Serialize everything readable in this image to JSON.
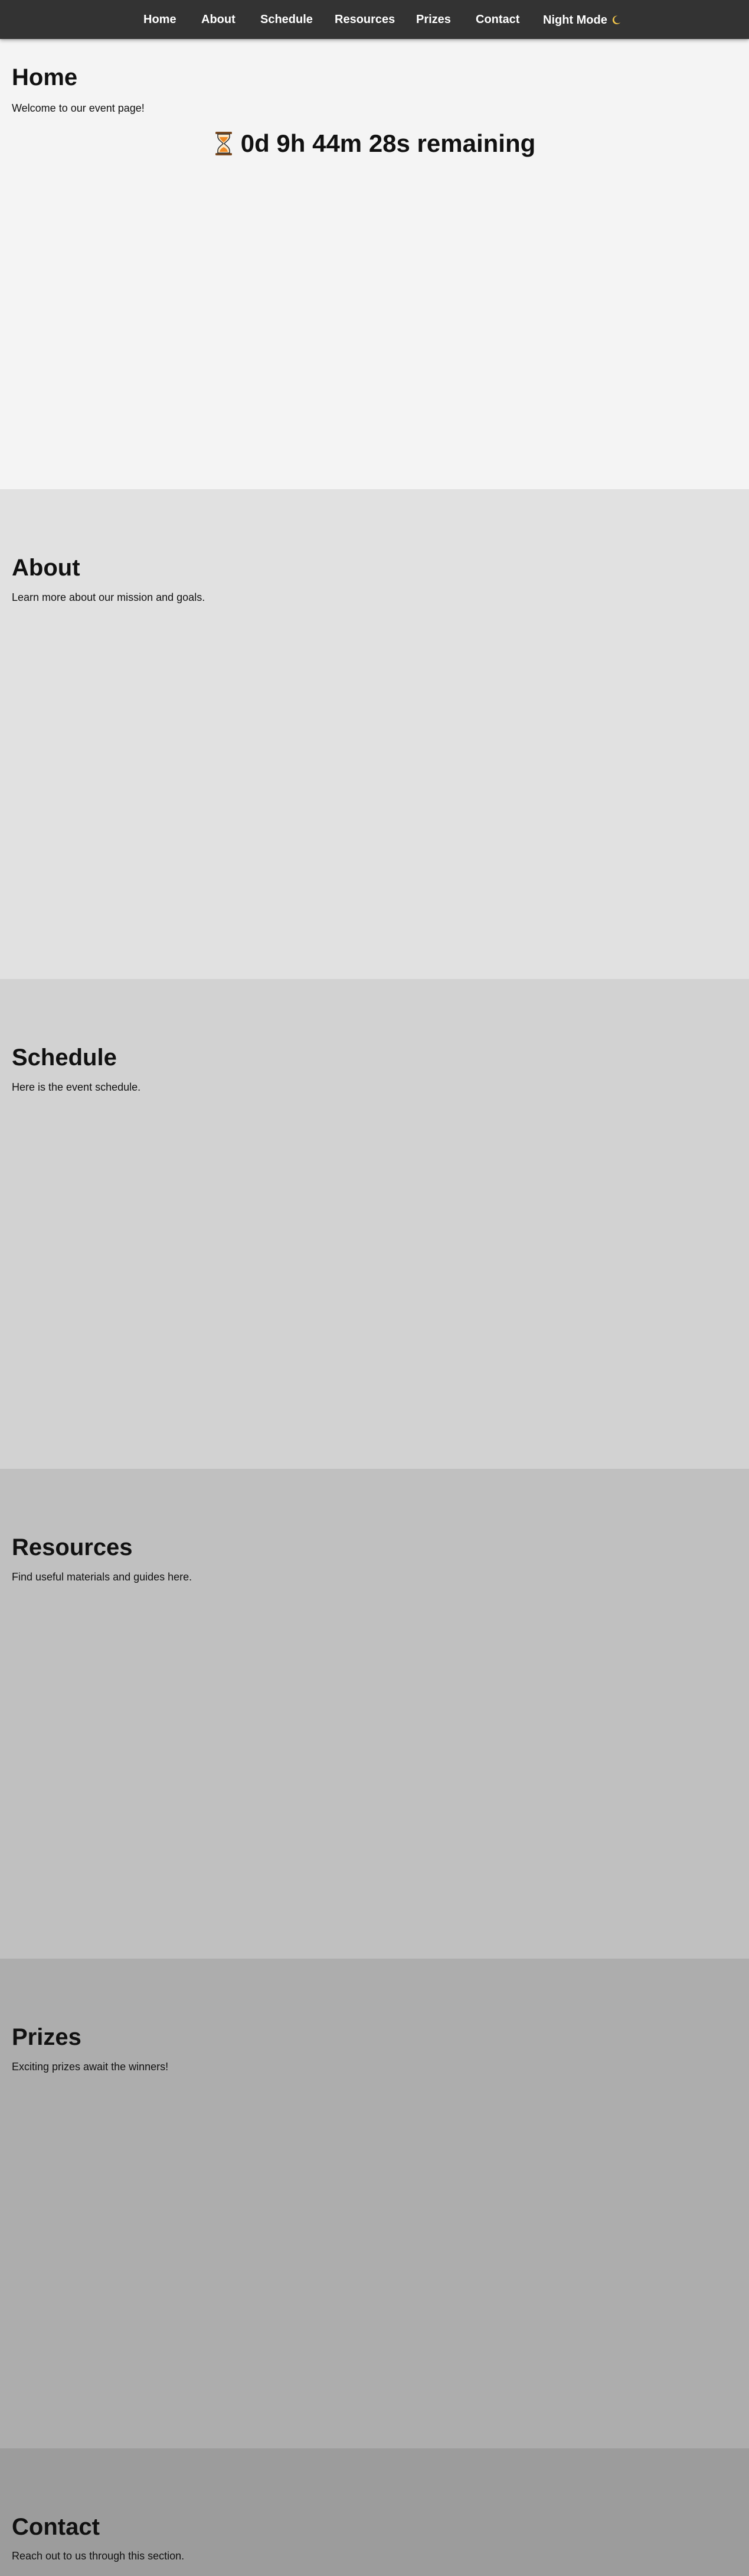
{
  "nav": {
    "items": [
      {
        "label": "Home",
        "target": "home"
      },
      {
        "label": "About",
        "target": "about"
      },
      {
        "label": "Schedule",
        "target": "schedule"
      },
      {
        "label": "Resources",
        "target": "resources"
      },
      {
        "label": "Prizes",
        "target": "prizes"
      },
      {
        "label": "Contact",
        "target": "contact"
      }
    ],
    "night_mode_label": "Night Mode",
    "night_mode_icon": "moon-icon"
  },
  "sections": {
    "home": {
      "title": "Home",
      "text": "Welcome to our event page!"
    },
    "about": {
      "title": "About",
      "text": "Learn more about our mission and goals."
    },
    "schedule": {
      "title": "Schedule",
      "text": "Here is the event schedule."
    },
    "resources": {
      "title": "Resources",
      "text": "Find useful materials and guides here."
    },
    "prizes": {
      "title": "Prizes",
      "text": "Exciting prizes await the winners!"
    },
    "contact": {
      "title": "Contact",
      "text": "Reach out to us through this section."
    }
  },
  "countdown": {
    "icon": "hourglass-icon",
    "text": "0d 9h 44m 28s remaining"
  },
  "colors": {
    "navbar": "#333333",
    "home_bg": "#f4f4f4",
    "about_bg": "#e1e1e1",
    "schedule_bg": "#d2d2d2",
    "resources_bg": "#c0c0c0",
    "prizes_bg": "#adadad",
    "contact_bg": "#9c9c9c",
    "moon": "#f3c64a",
    "hourglass_sand": "#f08a24"
  }
}
